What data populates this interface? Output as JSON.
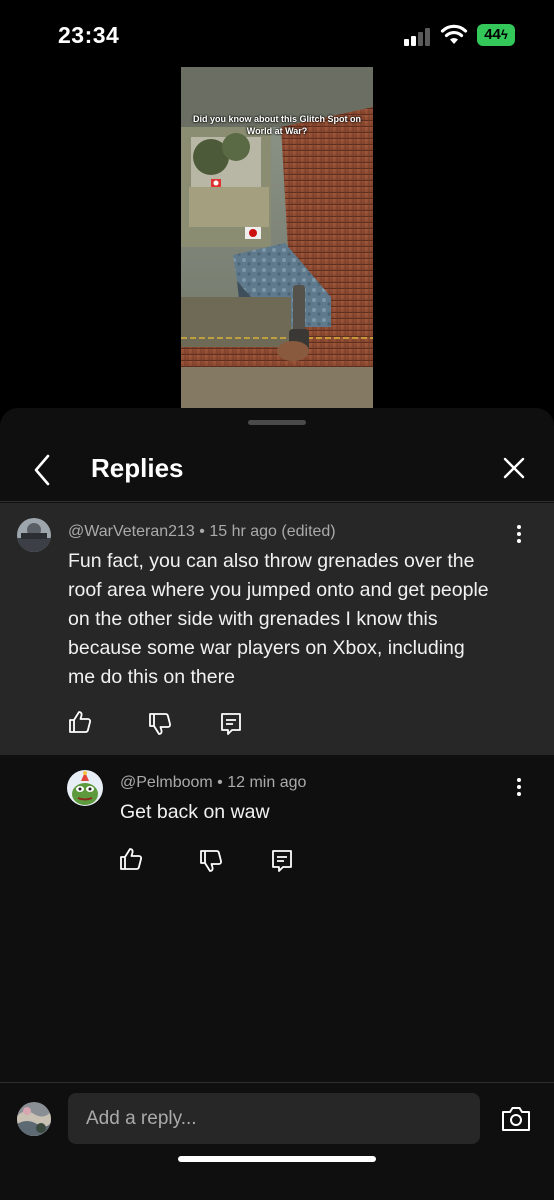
{
  "status_bar": {
    "time": "23:34",
    "battery": "44"
  },
  "video": {
    "caption": "Did you know about this Glitch Spot on World at War?"
  },
  "header": {
    "title": "Replies"
  },
  "main_comment": {
    "author": "@WarVeteran213",
    "time": "15 hr ago (edited)",
    "text": "Fun fact, you can also throw grenades over the roof area where you jumped onto and get people on the other side with grenades I know this because some war players on Xbox, including me do this on there",
    "lines": [
      "Fun fact, you can also throw grenades over the",
      "roof area where you jumped onto and get people",
      "on the other side with grenades I know this",
      "because some war players on Xbox, including",
      "me do this on there"
    ]
  },
  "reply": {
    "author": "@Pelmboom",
    "time": "12 min ago",
    "text": "Get back on waw"
  },
  "footer": {
    "placeholder": "Add a reply..."
  },
  "colors": {
    "background": "#0f0f0f",
    "highlight": "#272727",
    "meta_text": "#aaaaaa",
    "battery": "#34c759"
  },
  "icons": [
    "back-icon",
    "close-icon",
    "more-vert-icon",
    "like-icon",
    "dislike-icon",
    "reply-icon",
    "camera-icon",
    "wifi-icon",
    "signal-icon"
  ]
}
